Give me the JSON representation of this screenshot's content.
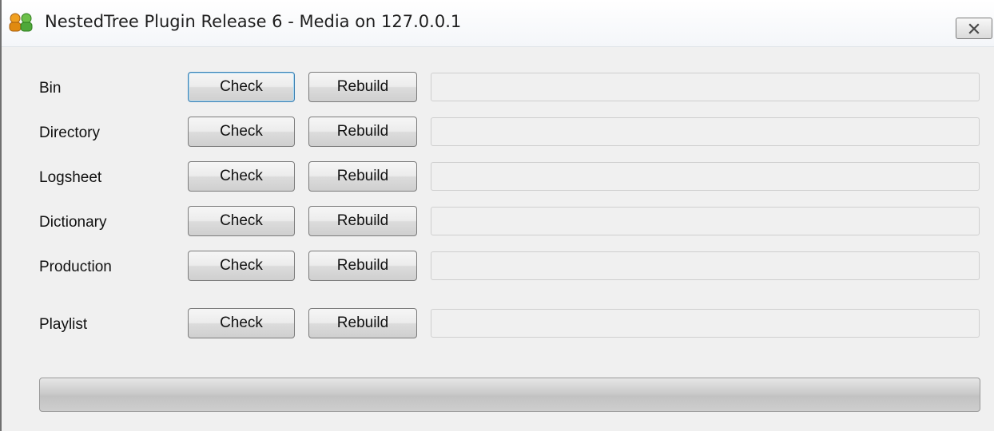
{
  "window": {
    "title": "NestedTree Plugin Release 6 - Media on 127.0.0.1",
    "icon": "users-icon",
    "close_icon": "close-icon"
  },
  "rows": [
    {
      "label": "Bin",
      "check_label": "Check",
      "rebuild_label": "Rebuild",
      "status": ""
    },
    {
      "label": "Directory",
      "check_label": "Check",
      "rebuild_label": "Rebuild",
      "status": ""
    },
    {
      "label": "Logsheet",
      "check_label": "Check",
      "rebuild_label": "Rebuild",
      "status": ""
    },
    {
      "label": "Dictionary",
      "check_label": "Check",
      "rebuild_label": "Rebuild",
      "status": ""
    },
    {
      "label": "Production",
      "check_label": "Check",
      "rebuild_label": "Rebuild",
      "status": ""
    },
    {
      "label": "Playlist",
      "check_label": "Check",
      "rebuild_label": "Rebuild",
      "status": ""
    }
  ],
  "progress": {
    "value": 0
  }
}
